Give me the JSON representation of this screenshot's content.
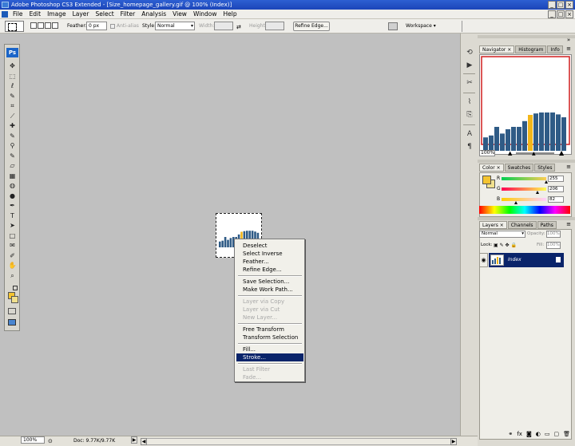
{
  "window": {
    "title": "Adobe Photoshop CS3 Extended - [Size_homepage_gallery.gif @ 100% (Index)]",
    "minimize_glyph": "_",
    "maximize_glyph": "□",
    "close_glyph": "×"
  },
  "menu": {
    "items": [
      "File",
      "Edit",
      "Image",
      "Layer",
      "Select",
      "Filter",
      "Analysis",
      "View",
      "Window",
      "Help"
    ]
  },
  "options": {
    "feather_label": "Feather:",
    "feather_value": "0 px",
    "anti_alias_label": "Anti-alias",
    "style_label": "Style:",
    "style_value": "Normal",
    "width_label": "Width:",
    "height_label": "Height:",
    "refine_edge_label": "Refine Edge...",
    "workspace_label": "Workspace ▾"
  },
  "toolbox": {
    "badge": "Ps",
    "tools": [
      "move-tool",
      "marquee-tool",
      "lasso-tool",
      "quick-selection-tool",
      "crop-tool",
      "slice-tool",
      "healing-brush-tool",
      "brush-tool",
      "clone-stamp-tool",
      "history-brush-tool",
      "eraser-tool",
      "gradient-tool",
      "blur-tool",
      "dodge-tool",
      "pen-tool",
      "type-tool",
      "path-selection-tool",
      "shape-tool",
      "notes-tool",
      "eyedropper-tool",
      "hand-tool",
      "zoom-tool"
    ],
    "glyphs": [
      "✥",
      "⬚",
      "ℓ",
      "✎",
      "⌗",
      "⟋",
      "✚",
      "✎",
      "⚲",
      "✎",
      "▱",
      "▦",
      "◍",
      "●",
      "✒",
      "T",
      "➤",
      "□",
      "✉",
      "✐",
      "✋",
      "⌕"
    ]
  },
  "context_menu": {
    "items": [
      {
        "label": "Deselect",
        "state": "normal"
      },
      {
        "label": "Select Inverse",
        "state": "normal"
      },
      {
        "label": "Feather...",
        "state": "normal"
      },
      {
        "label": "Refine Edge...",
        "state": "normal"
      },
      {
        "label": "Save Selection...",
        "state": "normal"
      },
      {
        "label": "Make Work Path...",
        "state": "normal"
      },
      {
        "label": "Layer via Copy",
        "state": "disabled"
      },
      {
        "label": "Layer via Cut",
        "state": "disabled"
      },
      {
        "label": "New Layer...",
        "state": "disabled"
      },
      {
        "label": "Free Transform",
        "state": "normal"
      },
      {
        "label": "Transform Selection",
        "state": "normal"
      },
      {
        "label": "Fill...",
        "state": "normal"
      },
      {
        "label": "Stroke...",
        "state": "highlighted"
      },
      {
        "label": "Last Filter",
        "state": "disabled"
      },
      {
        "label": "Fade...",
        "state": "disabled"
      }
    ]
  },
  "navigator": {
    "tabs": [
      "Navigator ×",
      "Histogram",
      "Info"
    ],
    "zoom_value": "100%",
    "bar_levels": [
      0.28,
      0.32,
      0.5,
      0.36,
      0.45,
      0.5,
      0.5,
      0.62,
      0.75,
      0.78,
      0.8,
      0.8,
      0.8,
      0.76,
      0.7
    ],
    "highlight_index": 8
  },
  "color_panel": {
    "tabs": [
      "Color ×",
      "Swatches",
      "Styles"
    ],
    "channels": [
      {
        "label": "R",
        "value": "255",
        "fraction": 1.0
      },
      {
        "label": "G",
        "value": "206",
        "fraction": 0.81
      },
      {
        "label": "B",
        "value": "82",
        "fraction": 0.32
      }
    ],
    "fg_color": "#f4c430",
    "bg_color": "#f1e08d"
  },
  "layers_panel": {
    "tabs": [
      "Layers ×",
      "Channels",
      "Paths"
    ],
    "blend_mode": "Normal",
    "opacity_label": "Opacity:",
    "opacity_value": "100%",
    "lock_label": "Lock:",
    "fill_label": "Fill:",
    "fill_value": "100%",
    "layer_name": "Index",
    "footer_icons": [
      "link-icon",
      "fx-icon",
      "mask-icon",
      "adjustment-icon",
      "group-icon",
      "new-layer-icon",
      "trash-icon"
    ],
    "footer_glyphs": [
      "⚭",
      "fx",
      "◙",
      "◐",
      "▭",
      "▢",
      "🗑"
    ]
  },
  "status": {
    "zoom": "100%",
    "doc_info": "Doc: 9.77K/9.77K"
  },
  "dock": {
    "icons": [
      "history-icon",
      "actions-icon",
      "tools-presets-icon",
      "brushes-icon",
      "clone-source-icon",
      "character-icon",
      "paragraph-icon"
    ],
    "glyphs": [
      "⟲",
      "▶",
      "✂",
      "⌇",
      "⎘",
      "A",
      "¶"
    ]
  },
  "accent_colors": {
    "bars": "#2f5b86",
    "bars_highlight": "#f2b61a",
    "selection_highlight": "#0a246a"
  }
}
